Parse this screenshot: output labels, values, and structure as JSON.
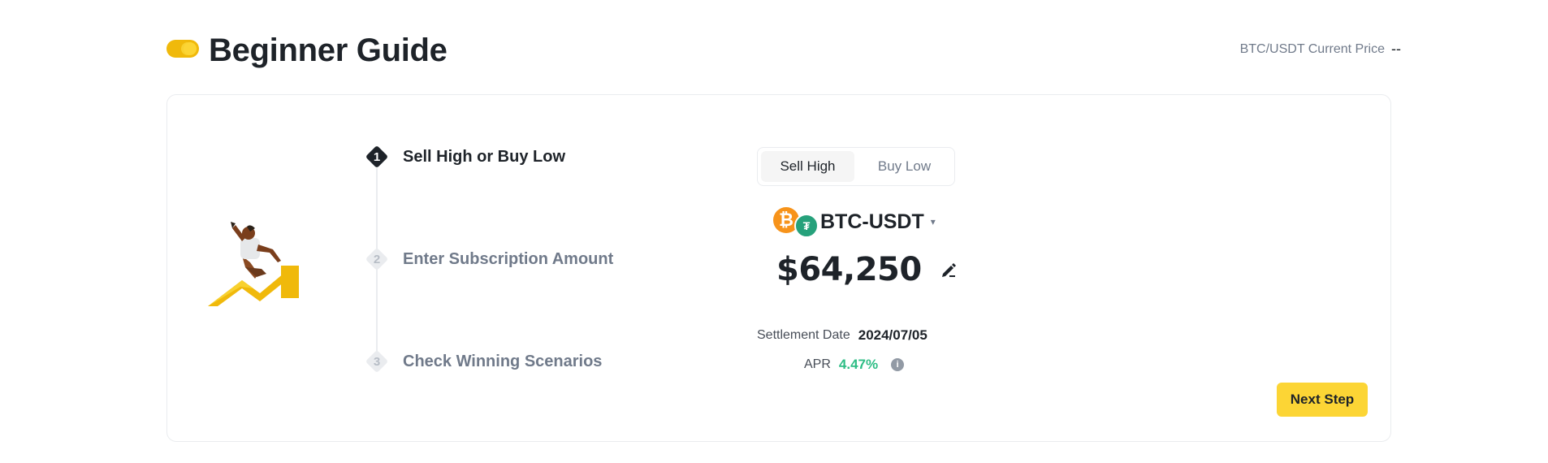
{
  "header": {
    "title": "Beginner Guide",
    "toggle_icon": "toggle-icon",
    "price_label": "BTC/USDT Current Price",
    "price_value": "--"
  },
  "steps": [
    {
      "number": "1",
      "label": "Sell High or Buy Low",
      "active": true
    },
    {
      "number": "2",
      "label": "Enter Subscription Amount",
      "active": false
    },
    {
      "number": "3",
      "label": "Check Winning Scenarios",
      "active": false
    }
  ],
  "mode_toggle": {
    "options": [
      "Sell High",
      "Buy Low"
    ],
    "selected": "Sell High"
  },
  "pair": {
    "name": "BTC-USDT",
    "base_icon": "btc-icon",
    "quote_icon": "usdt-icon",
    "chevron_icon": "chevron-down-icon"
  },
  "strike": {
    "price": "$64,250",
    "edit_icon": "edit-icon"
  },
  "settlement": {
    "label": "Settlement Date",
    "value": "2024/07/05"
  },
  "apr": {
    "label": "APR",
    "value": "4.47%",
    "info_icon": "info-icon"
  },
  "actions": {
    "next_label": "Next Step"
  },
  "colors": {
    "accent_yellow": "#FCD535",
    "brand_yellow": "#F0B90B",
    "positive_green": "#2EBD85",
    "text_primary": "#1E2329",
    "text_secondary": "#707A8A",
    "btc_orange": "#F7931A",
    "usdt_green": "#26A17B"
  }
}
